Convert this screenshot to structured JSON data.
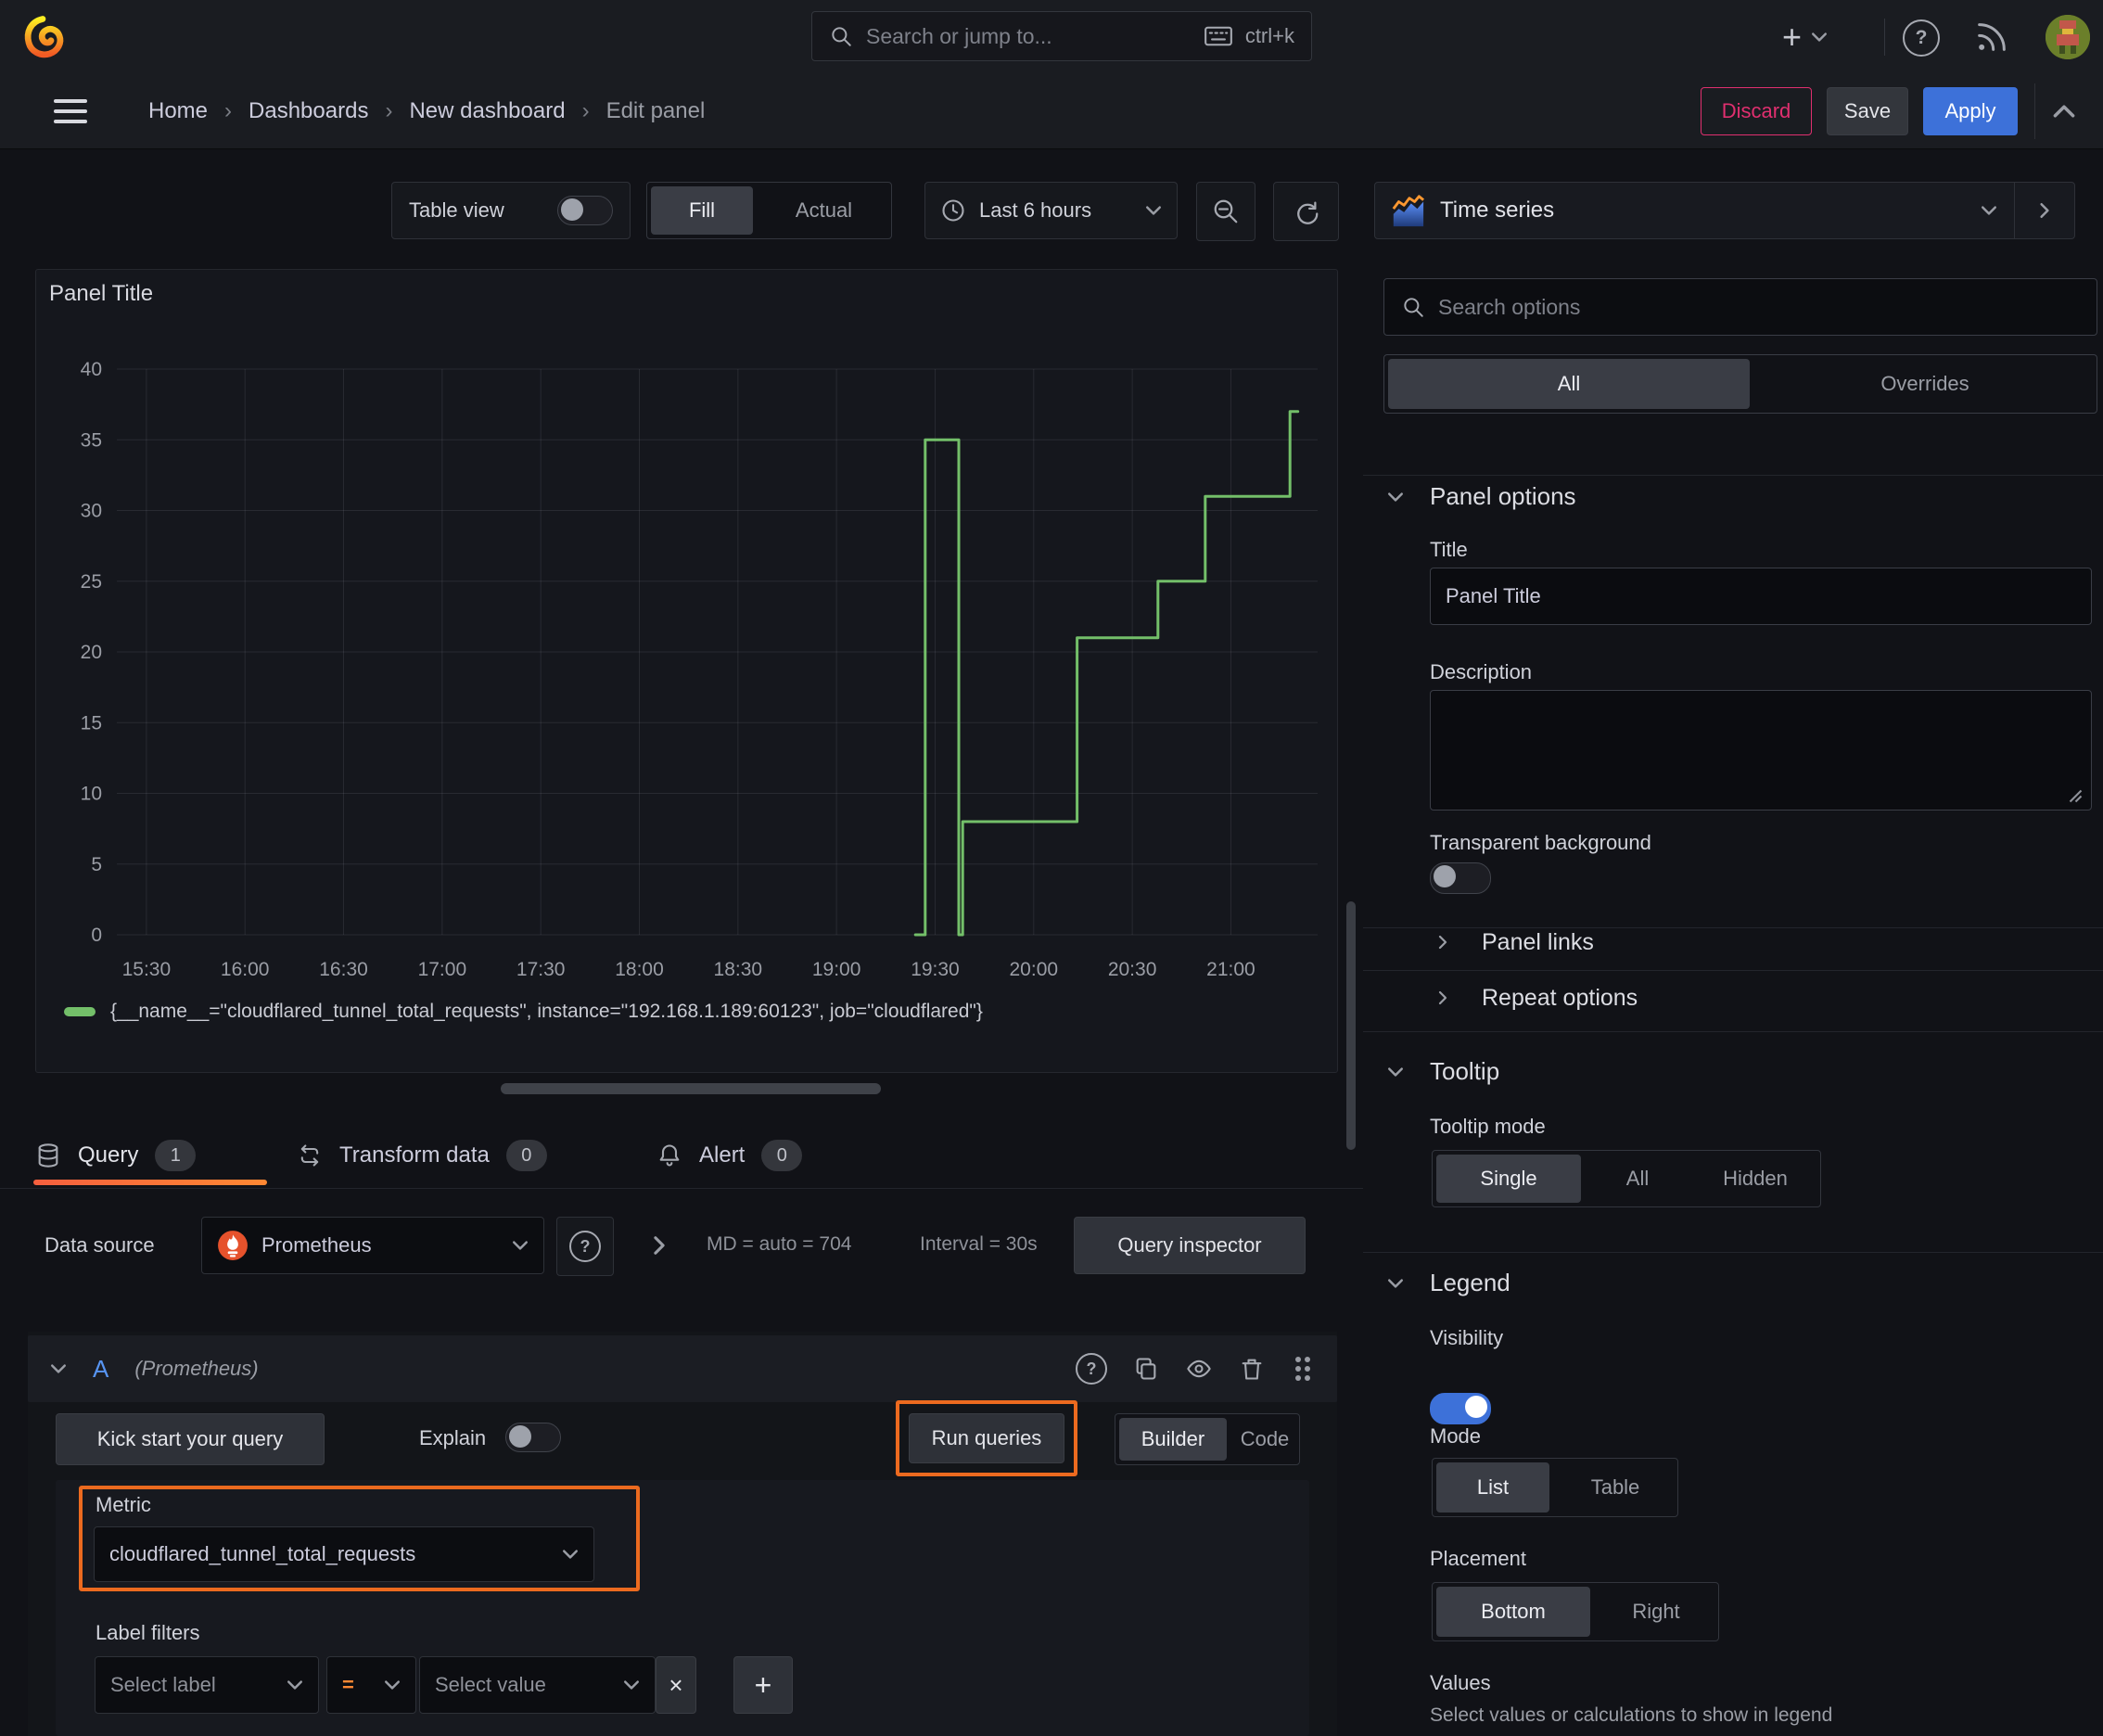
{
  "topbar": {
    "search_placeholder": "Search or jump to...",
    "search_shortcut": "ctrl+k"
  },
  "breadcrumb": {
    "items": [
      "Home",
      "Dashboards",
      "New dashboard",
      "Edit panel"
    ]
  },
  "header_actions": {
    "discard": "Discard",
    "save": "Save",
    "apply": "Apply"
  },
  "toolbar": {
    "table_view_label": "Table view",
    "fill": "Fill",
    "actual": "Actual",
    "time_range": "Last 6 hours"
  },
  "vis_picker": {
    "label": "Time series"
  },
  "panel": {
    "title": "Panel Title"
  },
  "chart_data": {
    "type": "line",
    "style": "step",
    "title": "Panel Title",
    "series": [
      {
        "name": "{__name__=\"cloudflared_tunnel_total_requests\", instance=\"192.168.1.189:60123\", job=\"cloudflared\"}",
        "color": "#73BF69",
        "points": [
          [
            19.4,
            0
          ],
          [
            19.45,
            0
          ],
          [
            19.45,
            35
          ],
          [
            19.62,
            35
          ],
          [
            19.62,
            0
          ],
          [
            19.64,
            0
          ],
          [
            19.64,
            8
          ],
          [
            20.22,
            8
          ],
          [
            20.22,
            21
          ],
          [
            20.63,
            21
          ],
          [
            20.63,
            25
          ],
          [
            20.87,
            25
          ],
          [
            20.87,
            31
          ],
          [
            21.3,
            31
          ],
          [
            21.3,
            37
          ],
          [
            21.34,
            37
          ]
        ]
      }
    ],
    "x_ticks": [
      "15:30",
      "16:00",
      "16:30",
      "17:00",
      "17:30",
      "18:00",
      "18:30",
      "19:00",
      "19:30",
      "20:00",
      "20:30",
      "21:00"
    ],
    "y_ticks": [
      0,
      5,
      10,
      15,
      20,
      25,
      30,
      35,
      40
    ],
    "ylim": [
      0,
      40
    ],
    "x_domain_hours": [
      15.35,
      21.44
    ],
    "grid": true,
    "legend_position": "bottom"
  },
  "query_tabs": {
    "query": {
      "label": "Query",
      "badge": "1"
    },
    "transform": {
      "label": "Transform data",
      "badge": "0"
    },
    "alert": {
      "label": "Alert",
      "badge": "0"
    }
  },
  "datasource_row": {
    "label": "Data source",
    "value": "Prometheus",
    "stats_md": "MD = auto = 704",
    "stats_interval": "Interval = 30s",
    "query_inspector": "Query inspector"
  },
  "query_editor": {
    "ref_id": "A",
    "ds_hint": "(Prometheus)",
    "kick_start": "Kick start your query",
    "explain": "Explain",
    "run_queries": "Run queries",
    "builder": "Builder",
    "code": "Code",
    "metric_label": "Metric",
    "metric_value": "cloudflared_tunnel_total_requests",
    "label_filters_label": "Label filters",
    "select_label_placeholder": "Select label",
    "operator": "=",
    "select_value_placeholder": "Select value"
  },
  "options_pane": {
    "search_placeholder": "Search options",
    "tabs": [
      "All",
      "Overrides"
    ],
    "panel_options": {
      "title": "Panel options",
      "title_label": "Title",
      "title_value": "Panel Title",
      "description_label": "Description",
      "transparent_label": "Transparent background",
      "panel_links": "Panel links",
      "repeat_options": "Repeat options"
    },
    "tooltip": {
      "title": "Tooltip",
      "mode_label": "Tooltip mode",
      "modes": [
        "Single",
        "All",
        "Hidden"
      ]
    },
    "legend": {
      "title": "Legend",
      "visibility_label": "Visibility",
      "mode_label": "Mode",
      "modes": [
        "List",
        "Table"
      ],
      "placement_label": "Placement",
      "placements": [
        "Bottom",
        "Right"
      ],
      "values_label": "Values",
      "values_hint": "Select values or calculations to show in legend"
    }
  },
  "colors": {
    "series_green": "#73BF69",
    "annotation_orange": "#EC6A1F",
    "apply_blue": "#3D71D9",
    "discard_pink": "#E02F6F",
    "operator_orange": "#FF8833",
    "refid_blue": "#5794F2",
    "toggle_on_blue": "#3D71D9",
    "tab_underline_from": "#F55F3E",
    "tab_underline_to": "#FF8833"
  }
}
